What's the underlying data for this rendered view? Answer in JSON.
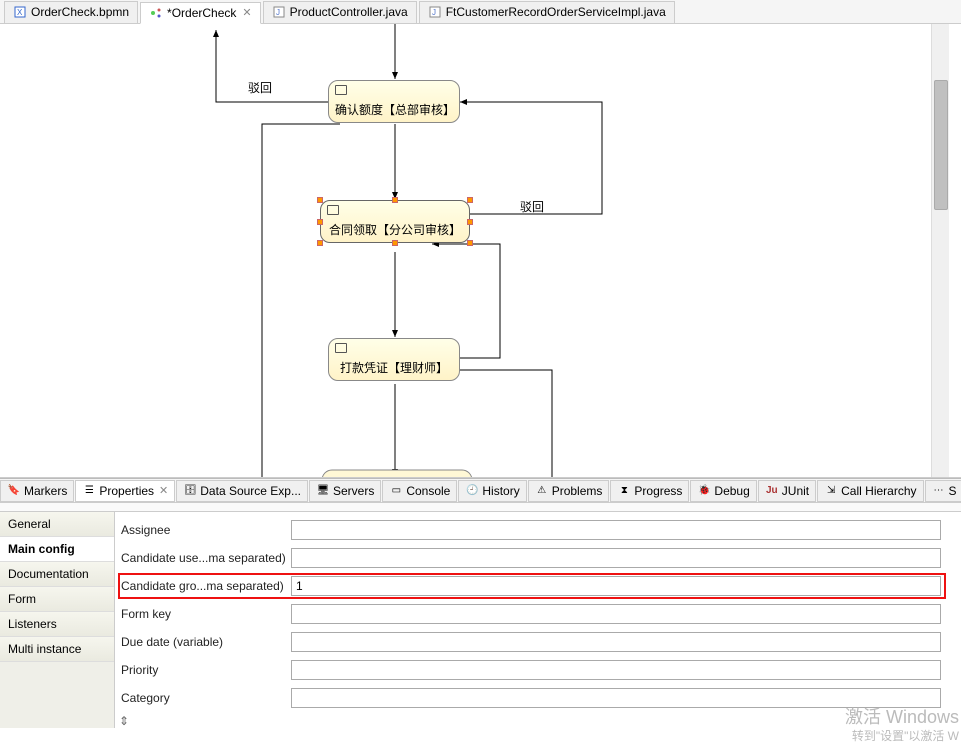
{
  "editor_tabs": {
    "tab0": {
      "label": "OrderCheck.bpmn"
    },
    "tab1": {
      "label": "*OrderCheck"
    },
    "tab2": {
      "label": "ProductController.java"
    },
    "tab3": {
      "label": "FtCustomerRecordOrderServiceImpl.java"
    }
  },
  "flow_labels": {
    "reject1": "驳回",
    "reject2": "驳回"
  },
  "tasks": {
    "t1": "确认额度【总部审核】",
    "t2": "合同领取【分公司审核】",
    "t3": "打款凭证【理财师】"
  },
  "view_tabs": {
    "markers": "Markers",
    "properties": "Properties",
    "dse": "Data Source Exp...",
    "servers": "Servers",
    "console": "Console",
    "history": "History",
    "problems": "Problems",
    "progress": "Progress",
    "debug": "Debug",
    "junit": "JUnit",
    "callhier": "Call Hierarchy",
    "last": "S"
  },
  "sidebar": {
    "general": "General",
    "main": "Main config",
    "doc": "Documentation",
    "form": "Form",
    "listeners": "Listeners",
    "multi": "Multi instance"
  },
  "fields": {
    "assignee": {
      "label": "Assignee",
      "value": ""
    },
    "cand_users": {
      "label": "Candidate use...ma separated)",
      "value": ""
    },
    "cand_groups": {
      "label": "Candidate gro...ma separated)",
      "value": "1"
    },
    "form_key": {
      "label": "Form key",
      "value": ""
    },
    "due_date": {
      "label": "Due date (variable)",
      "value": ""
    },
    "priority": {
      "label": "Priority",
      "value": ""
    },
    "category": {
      "label": "Category",
      "value": ""
    }
  },
  "watermark": {
    "main": "激活 Windows",
    "sub": "转到\"设置\"以激活 W"
  }
}
